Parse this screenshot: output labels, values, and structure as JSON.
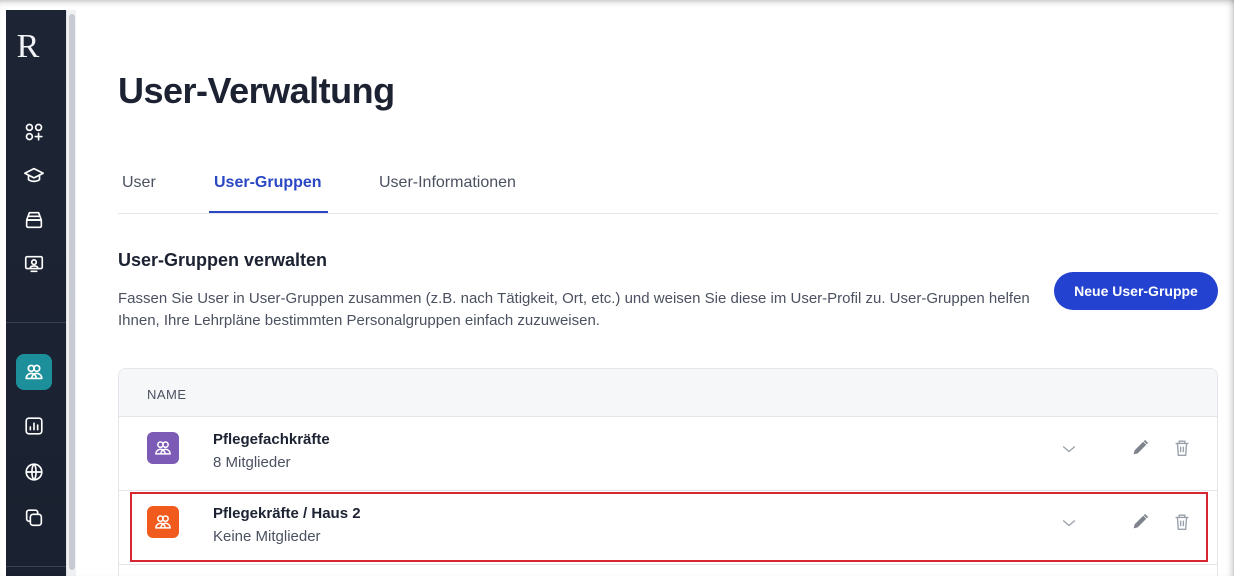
{
  "app": {
    "logo": "R"
  },
  "sidebar": {
    "items": [
      {
        "icon": "apps-plus-icon",
        "active": false
      },
      {
        "icon": "graduation-cap-icon",
        "active": false
      },
      {
        "icon": "archive-icon",
        "active": false
      },
      {
        "icon": "presentation-icon",
        "active": false
      },
      {
        "icon": "users-icon",
        "active": true
      },
      {
        "icon": "chart-icon",
        "active": false
      },
      {
        "icon": "globe-icon",
        "active": false
      },
      {
        "icon": "copy-icon",
        "active": false
      }
    ]
  },
  "page": {
    "title": "User-Verwaltung"
  },
  "tabs": [
    {
      "label": "User",
      "active": false
    },
    {
      "label": "User-Gruppen",
      "active": true
    },
    {
      "label": "User-Informationen",
      "active": false
    }
  ],
  "section": {
    "title": "User-Gruppen verwalten",
    "description": "Fassen Sie User in User-Gruppen zusammen (z.B. nach Tätigkeit, Ort, etc.) und weisen Sie diese im User-Profil zu. User-Gruppen helfen Ihnen, Ihre Lehrpläne bestimmten Personalgruppen einfach zuzuweisen.",
    "new_button": "Neue User-Gruppe"
  },
  "table": {
    "header": "NAME",
    "rows": [
      {
        "name": "Pflegefachkräfte",
        "members": "8 Mitglieder",
        "color": "#7b5bb6"
      },
      {
        "name": "Pflegekräfte / Haus 2",
        "members": "Keine Mitglieder",
        "color": "#f05a1d"
      }
    ]
  },
  "colors": {
    "accent": "#2342cf",
    "active_sidebar": "#1d8f9a",
    "highlight": "#d7262f"
  }
}
